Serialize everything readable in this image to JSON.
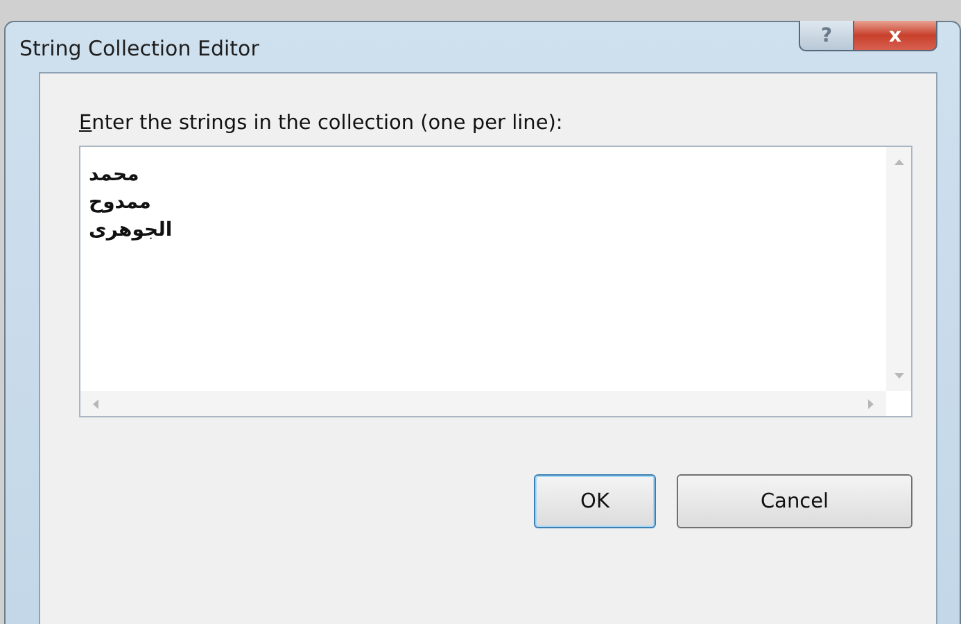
{
  "window": {
    "title": "String Collection Editor"
  },
  "help_button": {
    "label": "?"
  },
  "close_button": {
    "label": "x"
  },
  "prompt": "Enter the strings in the collection (one per line):",
  "lines": [
    "محمد",
    "ممدوح",
    "الجوهری"
  ],
  "ok_button": {
    "label": "OK"
  },
  "cancel_button": {
    "label": "Cancel"
  }
}
